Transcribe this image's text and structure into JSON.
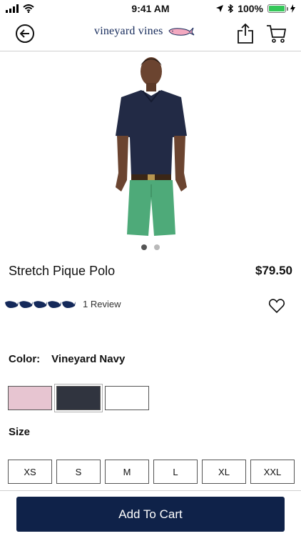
{
  "status_bar": {
    "time": "9:41 AM",
    "battery": "100%"
  },
  "nav": {
    "brand": "vineyard vines"
  },
  "product": {
    "title": "Stretch Pique Polo",
    "price": "$79.50",
    "rating_stars": 5,
    "review_count": "1 Review",
    "image_count": 2,
    "active_image_index": 0
  },
  "color": {
    "label": "Color:",
    "selected": "Vineyard Navy",
    "swatches": [
      {
        "name": "pink",
        "hex": "#e7c5d1"
      },
      {
        "name": "navy",
        "hex": "#30343f",
        "selected": true
      },
      {
        "name": "white",
        "hex": "#ffffff"
      }
    ]
  },
  "size": {
    "label": "Size",
    "options": [
      "XS",
      "S",
      "M",
      "L",
      "XL",
      "XXL"
    ]
  },
  "cart": {
    "add_label": "Add To Cart"
  },
  "colors": {
    "navy": "#0f2249",
    "brand_text": "#14295a",
    "battery_green": "#35c759"
  }
}
